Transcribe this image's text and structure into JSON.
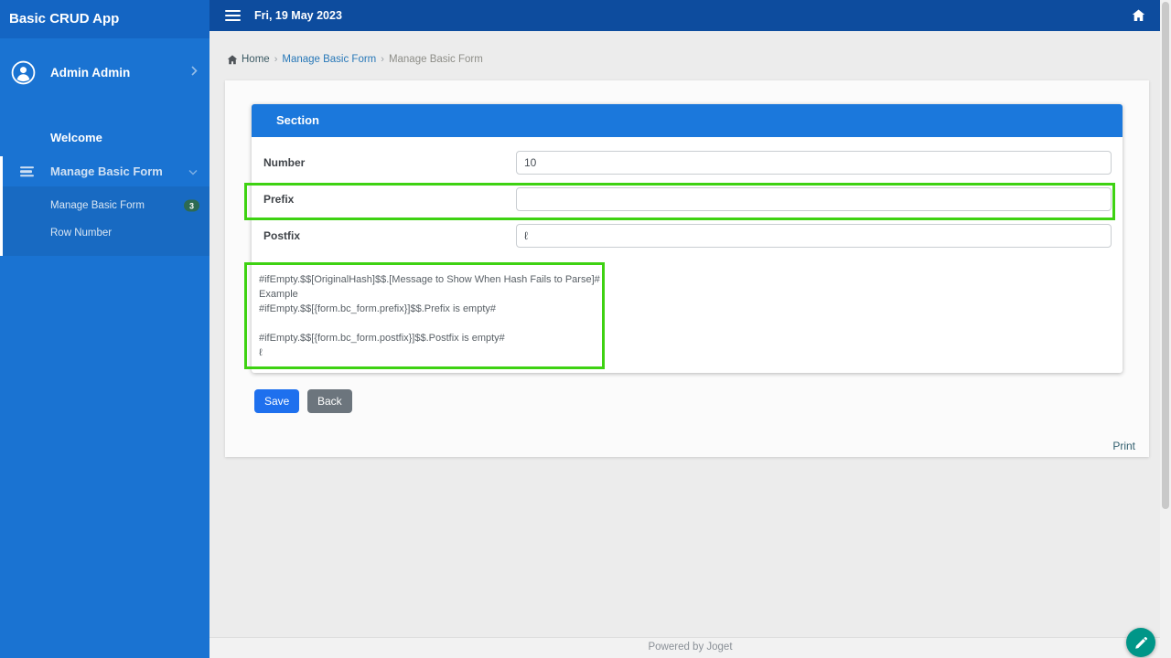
{
  "app": {
    "title": "Basic CRUD App"
  },
  "topbar": {
    "date": "Fri, 19 May 2023"
  },
  "sidebar": {
    "user": {
      "name": "Admin Admin"
    },
    "items": [
      {
        "label": "Welcome"
      },
      {
        "label": "Manage Basic Form"
      }
    ],
    "submenu": [
      {
        "label": "Manage Basic Form",
        "badge": "3"
      },
      {
        "label": "Row Number"
      }
    ]
  },
  "breadcrumb": {
    "separator": "›",
    "items": [
      "Home",
      "Manage Basic Form",
      "Manage Basic Form"
    ]
  },
  "form": {
    "section_title": "Section",
    "fields": [
      {
        "label": "Number",
        "value": "10"
      },
      {
        "label": "Prefix",
        "value": ""
      },
      {
        "label": "Postfix",
        "value": "ℓ"
      }
    ],
    "help_text": "#ifEmpty.$$[OriginalHash]$$.[Message to Show When Hash Fails to Parse]#\nExample\n#ifEmpty.$$[{form.bc_form.prefix}]$$.Prefix is empty#\n\n#ifEmpty.$$[{form.bc_form.postfix}]$$.Postfix is empty#\nℓ",
    "save_label": "Save",
    "back_label": "Back"
  },
  "panel": {
    "print_label": "Print"
  },
  "footer": {
    "text": "Powered by Joget"
  },
  "colors": {
    "sidebar": "#1a73d2",
    "sidebar_header": "#1465c3",
    "topbar": "#0d4c9e",
    "section_header": "#1b78dc",
    "save_button": "#1e70ee",
    "back_button": "#6c757d",
    "badge": "#2d6a52",
    "fab": "#009688",
    "annotation": "#3ed212"
  }
}
